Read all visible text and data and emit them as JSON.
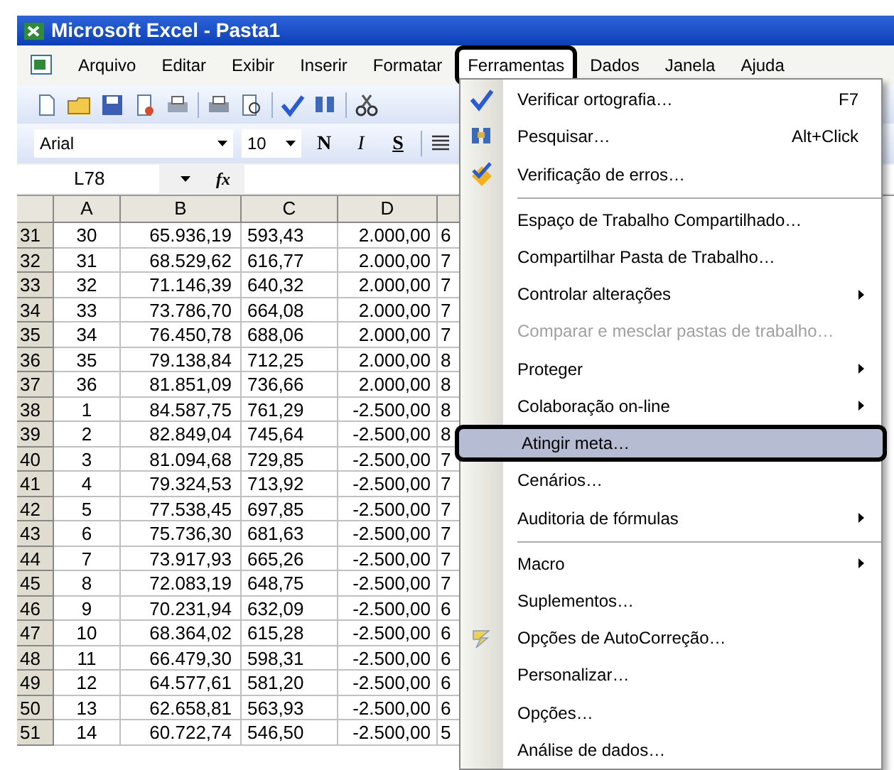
{
  "window": {
    "title": "Microsoft Excel - Pasta1"
  },
  "menu_bar": [
    {
      "label": "Arquivo",
      "selected": false
    },
    {
      "label": "Editar",
      "selected": false
    },
    {
      "label": "Exibir",
      "selected": false
    },
    {
      "label": "Inserir",
      "selected": false
    },
    {
      "label": "Formatar",
      "selected": false
    },
    {
      "label": "Ferramentas",
      "selected": true
    },
    {
      "label": "Dados",
      "selected": false
    },
    {
      "label": "Janela",
      "selected": false
    },
    {
      "label": "Ajuda",
      "selected": false
    }
  ],
  "format_toolbar": {
    "font": "Arial",
    "size": "10",
    "bold": "N",
    "italic": "I",
    "underline": "S"
  },
  "formula_bar": {
    "name_box": "L78",
    "fx": "fx"
  },
  "sheet": {
    "columns": [
      "A",
      "B",
      "C",
      "D",
      ""
    ],
    "rows": [
      {
        "header": "31",
        "cells": [
          "30",
          "65.936,19",
          "593,43",
          "2.000,00",
          "6"
        ]
      },
      {
        "header": "32",
        "cells": [
          "31",
          "68.529,62",
          "616,77",
          "2.000,00",
          "7"
        ]
      },
      {
        "header": "33",
        "cells": [
          "32",
          "71.146,39",
          "640,32",
          "2.000,00",
          "7"
        ]
      },
      {
        "header": "34",
        "cells": [
          "33",
          "73.786,70",
          "664,08",
          "2.000,00",
          "7"
        ]
      },
      {
        "header": "35",
        "cells": [
          "34",
          "76.450,78",
          "688,06",
          "2.000,00",
          "7"
        ]
      },
      {
        "header": "36",
        "cells": [
          "35",
          "79.138,84",
          "712,25",
          "2.000,00",
          "8"
        ]
      },
      {
        "header": "37",
        "cells": [
          "36",
          "81.851,09",
          "736,66",
          "2.000,00",
          "8"
        ]
      },
      {
        "header": "38",
        "cells": [
          "1",
          "84.587,75",
          "761,29",
          "-2.500,00",
          "8"
        ]
      },
      {
        "header": "39",
        "cells": [
          "2",
          "82.849,04",
          "745,64",
          "-2.500,00",
          "8"
        ]
      },
      {
        "header": "40",
        "cells": [
          "3",
          "81.094,68",
          "729,85",
          "-2.500,00",
          "7"
        ]
      },
      {
        "header": "41",
        "cells": [
          "4",
          "79.324,53",
          "713,92",
          "-2.500,00",
          "7"
        ]
      },
      {
        "header": "42",
        "cells": [
          "5",
          "77.538,45",
          "697,85",
          "-2.500,00",
          "7"
        ]
      },
      {
        "header": "43",
        "cells": [
          "6",
          "75.736,30",
          "681,63",
          "-2.500,00",
          "7"
        ]
      },
      {
        "header": "44",
        "cells": [
          "7",
          "73.917,93",
          "665,26",
          "-2.500,00",
          "7"
        ]
      },
      {
        "header": "45",
        "cells": [
          "8",
          "72.083,19",
          "648,75",
          "-2.500,00",
          "7"
        ]
      },
      {
        "header": "46",
        "cells": [
          "9",
          "70.231,94",
          "632,09",
          "-2.500,00",
          "6"
        ]
      },
      {
        "header": "47",
        "cells": [
          "10",
          "68.364,02",
          "615,28",
          "-2.500,00",
          "6"
        ]
      },
      {
        "header": "48",
        "cells": [
          "11",
          "66.479,30",
          "598,31",
          "-2.500,00",
          "6"
        ]
      },
      {
        "header": "49",
        "cells": [
          "12",
          "64.577,61",
          "581,20",
          "-2.500,00",
          "6"
        ]
      },
      {
        "header": "50",
        "cells": [
          "13",
          "62.658,81",
          "563,93",
          "-2.500,00",
          "6"
        ]
      },
      {
        "header": "51",
        "cells": [
          "14",
          "60.722,74",
          "546,50",
          "-2.500,00",
          "5"
        ]
      }
    ]
  },
  "tools_menu": [
    {
      "kind": "item",
      "label": "Verificar ortografia…",
      "shortcut": "F7",
      "submenu": false,
      "disabled": false,
      "selected": false
    },
    {
      "kind": "item",
      "label": "Pesquisar…",
      "shortcut": "Alt+Click",
      "submenu": false,
      "disabled": false,
      "selected": false
    },
    {
      "kind": "item",
      "label": "Verificação de erros…",
      "submenu": false,
      "disabled": false,
      "selected": false
    },
    {
      "kind": "separator"
    },
    {
      "kind": "item",
      "label": "Espaço de Trabalho Compartilhado…",
      "submenu": false,
      "disabled": false,
      "selected": false
    },
    {
      "kind": "item",
      "label": "Compartilhar Pasta de Trabalho…",
      "submenu": false,
      "disabled": false,
      "selected": false
    },
    {
      "kind": "item",
      "label": "Controlar alterações",
      "submenu": true,
      "disabled": false,
      "selected": false
    },
    {
      "kind": "item",
      "label": "Comparar e mesclar pastas de trabalho…",
      "submenu": false,
      "disabled": true,
      "selected": false
    },
    {
      "kind": "item",
      "label": "Proteger",
      "submenu": true,
      "disabled": false,
      "selected": false
    },
    {
      "kind": "item",
      "label": "Colaboração on-line",
      "submenu": true,
      "disabled": false,
      "selected": false
    },
    {
      "kind": "item",
      "label": "Atingir meta…",
      "submenu": false,
      "disabled": false,
      "selected": true
    },
    {
      "kind": "item",
      "label": "Cenários…",
      "submenu": false,
      "disabled": false,
      "selected": false
    },
    {
      "kind": "item",
      "label": "Auditoria de fórmulas",
      "submenu": true,
      "disabled": false,
      "selected": false
    },
    {
      "kind": "separator"
    },
    {
      "kind": "item",
      "label": "Macro",
      "submenu": true,
      "disabled": false,
      "selected": false
    },
    {
      "kind": "item",
      "label": "Suplementos…",
      "submenu": false,
      "disabled": false,
      "selected": false
    },
    {
      "kind": "item",
      "label": "Opções de AutoCorreção…",
      "submenu": false,
      "disabled": false,
      "selected": false
    },
    {
      "kind": "item",
      "label": "Personalizar…",
      "submenu": false,
      "disabled": false,
      "selected": false
    },
    {
      "kind": "item",
      "label": "Opções…",
      "submenu": false,
      "disabled": false,
      "selected": false
    },
    {
      "kind": "item",
      "label": "Análise de dados…",
      "submenu": false,
      "disabled": false,
      "selected": false
    }
  ]
}
